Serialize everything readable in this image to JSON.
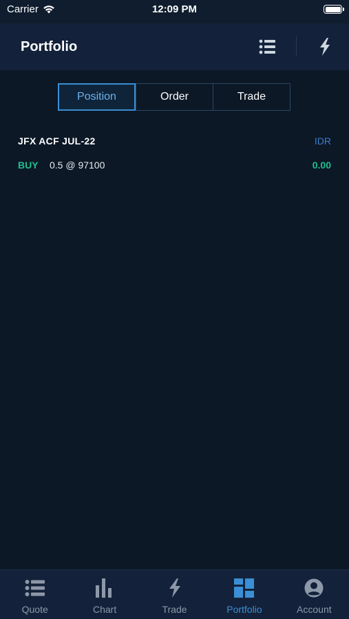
{
  "status_bar": {
    "carrier": "Carrier",
    "time": "12:09 PM"
  },
  "header": {
    "title": "Portfolio",
    "list_icon": "list-icon",
    "bolt_icon": "bolt-icon"
  },
  "segments": [
    {
      "label": "Position",
      "active": true
    },
    {
      "label": "Order",
      "active": false
    },
    {
      "label": "Trade",
      "active": false
    }
  ],
  "position": {
    "symbol": "JFX ACF JUL-22",
    "currency": "IDR",
    "side": "BUY",
    "quantity_price": "0.5 @ 97100",
    "pnl": "0.00"
  },
  "tabbar": [
    {
      "label": "Quote",
      "icon": "list-icon",
      "active": false
    },
    {
      "label": "Chart",
      "icon": "bar-chart-icon",
      "active": false
    },
    {
      "label": "Trade",
      "icon": "bolt-icon",
      "active": false
    },
    {
      "label": "Portfolio",
      "icon": "portfolio-grid-icon",
      "active": true
    },
    {
      "label": "Account",
      "icon": "account-icon",
      "active": false
    }
  ],
  "colors": {
    "background": "#0c1826",
    "header": "#13223a",
    "accent": "#3a8fd6",
    "buy_green": "#1fbf8f",
    "currency_blue": "#3a7ecf",
    "inactive_gray": "#8d98a8"
  }
}
